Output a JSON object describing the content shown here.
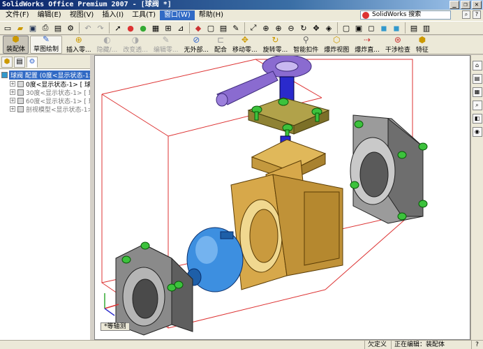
{
  "window": {
    "title": "SolidWorks Office Premium 2007 - [球阀 *]",
    "min": "_",
    "restore": "❐",
    "close": "✕"
  },
  "menus": [
    "文件(F)",
    "编辑(E)",
    "视图(V)",
    "插入(I)",
    "工具(T)",
    "窗口(W)",
    "帮助(H)"
  ],
  "active_menu_index": 5,
  "search": {
    "placeholder": "SolidWorks 搜索"
  },
  "commands": {
    "assembly": "装配体",
    "sketch": "草图绘制",
    "insert_component": "插入零...",
    "hide_show": "隐藏/...",
    "change_transparency": "改变透...",
    "edit_component": "编辑零...",
    "no_external": "无外部...",
    "mate": "配合",
    "move_component": "移动零...",
    "rotate_component": "旋转零...",
    "smart_fastener": "智能扣件",
    "exploded_view": "爆炸视图",
    "explode_line": "爆炸直...",
    "interference": "干涉检查",
    "feature": "特征"
  },
  "tree": {
    "root": "球阀 配置 (0度<显示状态-1>)",
    "items": [
      {
        "label": "0度<显示状态-1> [ 球阀",
        "dim": false
      },
      {
        "label": "30度<显示状态-1> [ 球阀",
        "dim": true
      },
      {
        "label": "60度<显示状态-1> [ 球阀",
        "dim": true
      },
      {
        "label": "剖视模型<显示状态-1> [",
        "dim": true
      }
    ]
  },
  "view_tab": "*等轴测",
  "status": {
    "under_defined": "欠定义",
    "editing": "正在编辑：装配体",
    "help": "?"
  },
  "colors": {
    "body_brass": "#d7a84a",
    "ball_blue": "#3d8fe0",
    "handle_purple": "#8a6bd0",
    "bolt_green": "#3cc23c",
    "flange_gray": "#8a8a8a",
    "bounding_red": "#d33"
  }
}
